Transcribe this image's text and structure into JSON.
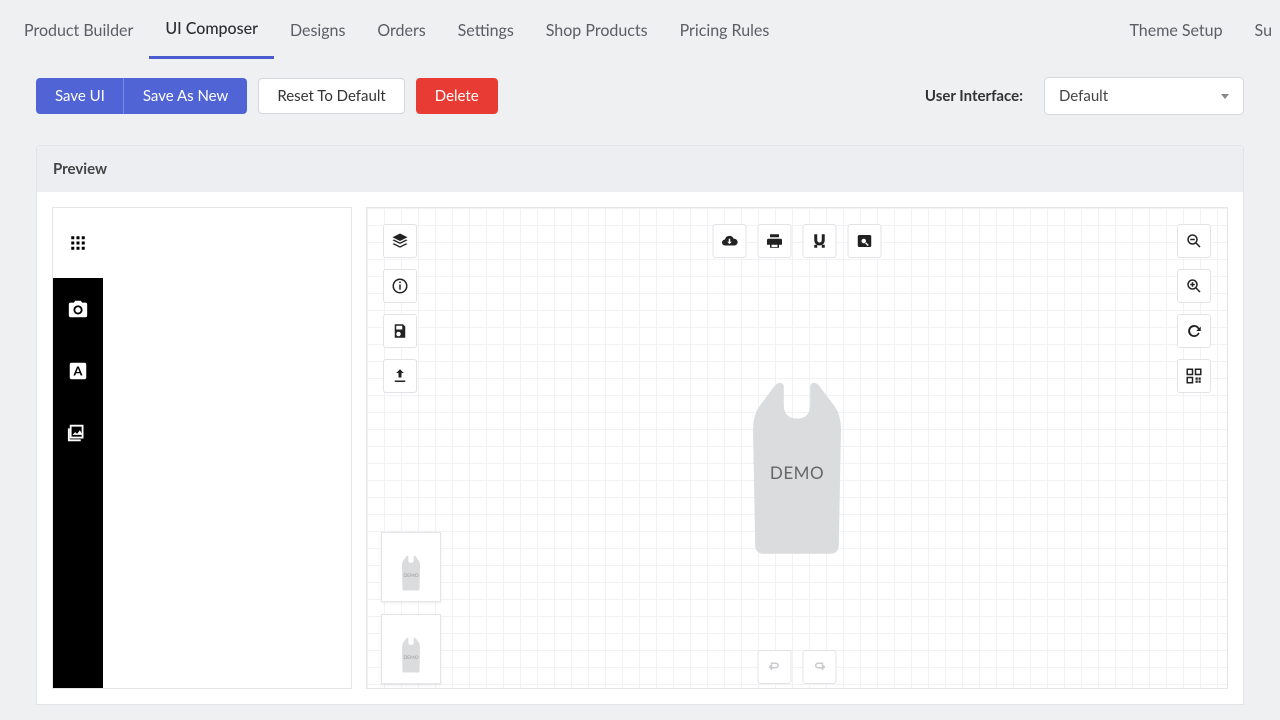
{
  "nav": {
    "tabs": [
      "Product Builder",
      "UI Composer",
      "Designs",
      "Orders",
      "Settings",
      "Shop Products",
      "Pricing Rules"
    ],
    "active": 1,
    "right": [
      "Theme Setup",
      "Su"
    ]
  },
  "actions": {
    "saveui": "Save UI",
    "saveas": "Save As New",
    "reset": "Reset To Default",
    "delete": "Delete",
    "uiLabel": "User Interface:",
    "uiValue": "Default"
  },
  "preview": {
    "title": "Preview",
    "demo": "DEMO",
    "thumbDemo": "DEMO"
  }
}
